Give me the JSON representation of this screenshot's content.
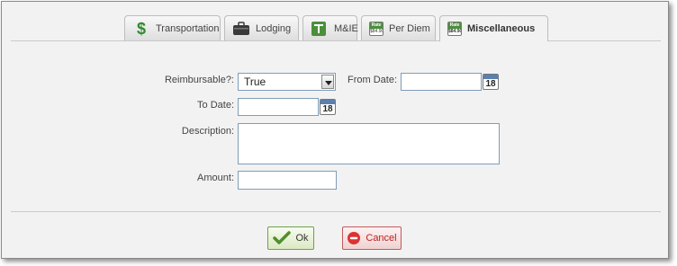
{
  "tabs": [
    {
      "label": "Transportation",
      "icon": "dollar-icon"
    },
    {
      "label": "Lodging",
      "icon": "briefcase-icon"
    },
    {
      "label": "M&IE",
      "icon": "meal-icon"
    },
    {
      "label": "Per Diem",
      "icon": "rate-icon"
    },
    {
      "label": "Miscellaneous",
      "icon": "rate-icon",
      "active": true
    }
  ],
  "rate_icon": {
    "top": "Rate",
    "bottom": "$84.90"
  },
  "form": {
    "reimbursable_label": "Reimbursable?:",
    "reimbursable_value": "True",
    "from_date_label": "From Date:",
    "to_date_label": "To Date:",
    "description_label": "Description:",
    "amount_label": "Amount:",
    "calendar_day": "18"
  },
  "buttons": {
    "ok": "Ok",
    "cancel": "Cancel"
  },
  "colors": {
    "accent_green": "#2e8b2e",
    "cancel_red": "#cc2222"
  }
}
